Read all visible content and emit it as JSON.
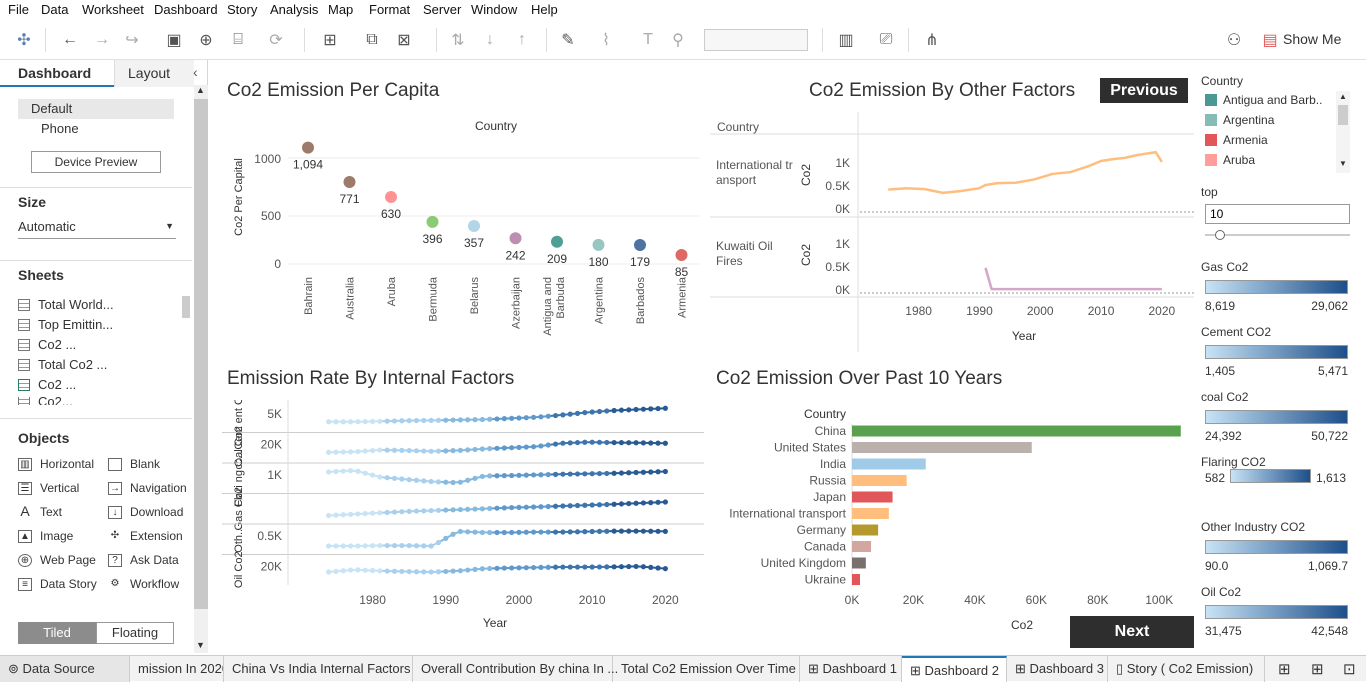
{
  "menu": [
    "File",
    "Data",
    "Worksheet",
    "Dashboard",
    "Story",
    "Analysis",
    "Map",
    "Format",
    "Server",
    "Window",
    "Help"
  ],
  "toolbar": {
    "show_me": "Show Me"
  },
  "left": {
    "tab_dashboard": "Dashboard",
    "tab_layout": "Layout",
    "device_default": "Default",
    "device_phone": "Phone",
    "device_preview": "Device Preview",
    "size_title": "Size",
    "size_value": "Automatic",
    "sheets_title": "Sheets",
    "sheets": [
      "Total World...",
      "Top Emittin...",
      "Co2 ...",
      "Total Co2 ...",
      "Co2 ...",
      "Co2..."
    ],
    "objects_title": "Objects",
    "objects": [
      "Horizontal",
      "Blank",
      "Vertical",
      "Navigation",
      "Text",
      "Download",
      "Image",
      "Extension",
      "Web Page",
      "Ask Data",
      "Data Story",
      "Workflow"
    ],
    "tiled": "Tiled",
    "floating": "Floating"
  },
  "dashboard": {
    "title1": "Co2 Emission Per Capita",
    "title2": "Co2 Emission By Other Factors",
    "title3": "Emission Rate By Internal Factors",
    "title4": "Co2 Emission Over Past 10 Years",
    "previous": "Previous",
    "next": "Next"
  },
  "chart_data": [
    {
      "type": "scatter",
      "title": "Co2 Emission Per Capita",
      "column_header": "Country",
      "ylabel": "Co2 Per Capital",
      "yticks": [
        "1000",
        "500",
        "0"
      ],
      "ylim": [
        0,
        1150
      ],
      "categories": [
        "Bahrain",
        "Australia",
        "Aruba",
        "Bermuda",
        "Belarus",
        "Azerbaijan",
        "Antigua and Barbuda",
        "Argentina",
        "Barbados",
        "Armenia"
      ],
      "values": [
        1094,
        771,
        630,
        396,
        357,
        242,
        209,
        180,
        179,
        85
      ],
      "labels": [
        "1,094",
        "771",
        "630",
        "396",
        "357",
        "242",
        "209",
        "180",
        "179",
        "85"
      ],
      "colors": [
        "#8c6450",
        "#8c6450",
        "#ff8080",
        "#76c35b",
        "#a6cee3",
        "#b07aa1",
        "#2f8f85",
        "#86bcb6",
        "#2f5b8f",
        "#d84e4e"
      ]
    },
    {
      "type": "line",
      "title": "Co2 Emission By Other Factors",
      "row_header": "Country",
      "xlabel": "Year",
      "xticks": [
        "1980",
        "1990",
        "2000",
        "2010",
        "2020"
      ],
      "xlim": [
        1972,
        2022
      ],
      "ylabel": "Co2",
      "panels": [
        {
          "name": "International transport",
          "yticks": [
            "1K",
            "0.5K",
            "0K"
          ],
          "ylim": [
            0,
            1300
          ],
          "color": "#ffbe7d",
          "x": [
            1975,
            1978,
            1981,
            1984,
            1987,
            1990,
            1991,
            1993,
            1996,
            1999,
            2002,
            2005,
            2008,
            2010,
            2012,
            2014,
            2016,
            2018,
            2019,
            2020
          ],
          "y": [
            420,
            450,
            430,
            350,
            390,
            450,
            520,
            560,
            570,
            640,
            760,
            800,
            930,
            1040,
            1080,
            1110,
            1170,
            1210,
            1230,
            1020
          ]
        },
        {
          "name": "Kuwaiti Oil Fires",
          "yticks": [
            "1K",
            "0.5K",
            "0K"
          ],
          "ylim": [
            0,
            1300
          ],
          "color": "#d4a6c8",
          "x": [
            1991,
            1992,
            2020
          ],
          "y": [
            480,
            20,
            20
          ]
        }
      ]
    },
    {
      "type": "line",
      "title": "Emission Rate By Internal Factors",
      "xlabel": "Year",
      "xticks": [
        "1980",
        "1990",
        "2000",
        "2010",
        "2020"
      ],
      "xlim": [
        1972,
        2022
      ],
      "rows": [
        {
          "label": "Cem ent Co2",
          "tick": "5K"
        },
        {
          "label": "coal Co2",
          "tick": "20K"
        },
        {
          "label": "Flari ng C...",
          "tick": "1K"
        },
        {
          "label": "Gas Co2",
          "tick": ""
        },
        {
          "label": "Oth...",
          "tick": "0.5K"
        },
        {
          "label": "Oil Co2",
          "tick": "20K"
        }
      ]
    },
    {
      "type": "bar",
      "title": "Co2 Emission Over Past 10 Years",
      "row_header": "Country",
      "xlabel": "Co2",
      "xticks": [
        "0K",
        "20K",
        "40K",
        "60K",
        "80K",
        "100K"
      ],
      "xlim": [
        0,
        110000
      ],
      "categories": [
        "China",
        "United States",
        "India",
        "Russia",
        "Japan",
        "International transport",
        "Germany",
        "Canada",
        "United Kingdom",
        "Ukraine"
      ],
      "values": [
        107000,
        58500,
        24000,
        17800,
        13200,
        12000,
        8500,
        6200,
        4500,
        2600
      ],
      "colors": [
        "#59a14f",
        "#bab0ac",
        "#a0cbe8",
        "#ffbe7d",
        "#e15759",
        "#ffbe7d",
        "#b6992d",
        "#d4a6a0",
        "#79706e",
        "#e15759"
      ]
    }
  ],
  "legends": {
    "country_title": "Country",
    "countries": [
      {
        "name": "Antigua and Barb..",
        "color": "#499894"
      },
      {
        "name": "Argentina",
        "color": "#86bcb6"
      },
      {
        "name": "Armenia",
        "color": "#e15759"
      },
      {
        "name": "Aruba",
        "color": "#ff9d9a"
      }
    ],
    "top_title": "top",
    "top_value": "10",
    "ranges": [
      {
        "title": "Gas Co2",
        "min": "8,619",
        "max": "29,062"
      },
      {
        "title": "Cement CO2",
        "min": "1,405",
        "max": "5,471"
      },
      {
        "title": "coal Co2",
        "min": "24,392",
        "max": "50,722"
      },
      {
        "title": "Flaring CO2",
        "min": "582",
        "max": "1,613"
      },
      {
        "title": "Other Industry CO2",
        "min": "90.0",
        "max": "1,069.7"
      },
      {
        "title": "Oil Co2",
        "min": "31,475",
        "max": "42,548"
      }
    ]
  },
  "status_tabs": [
    "Data Source",
    "mission In 2020",
    "China Vs India Internal Factors",
    "Overall Contribution By china In ...",
    "Total Co2 Emission Over Time",
    "Dashboard 1",
    "Dashboard 2",
    "Dashboard 3",
    "Story ( Co2 Emission)"
  ]
}
